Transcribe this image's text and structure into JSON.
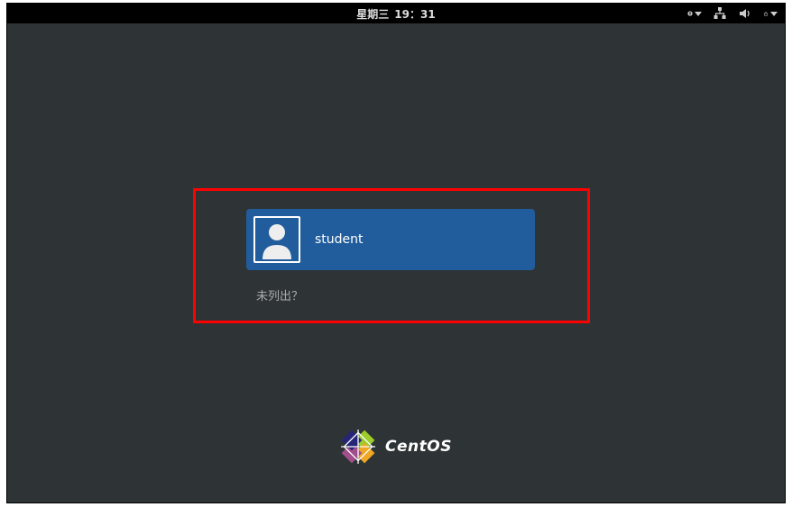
{
  "topbar": {
    "day": "星期三",
    "time": "19：31"
  },
  "login": {
    "username": "student",
    "not_listed_label": "未列出？"
  },
  "branding": {
    "name": "CentOS"
  }
}
